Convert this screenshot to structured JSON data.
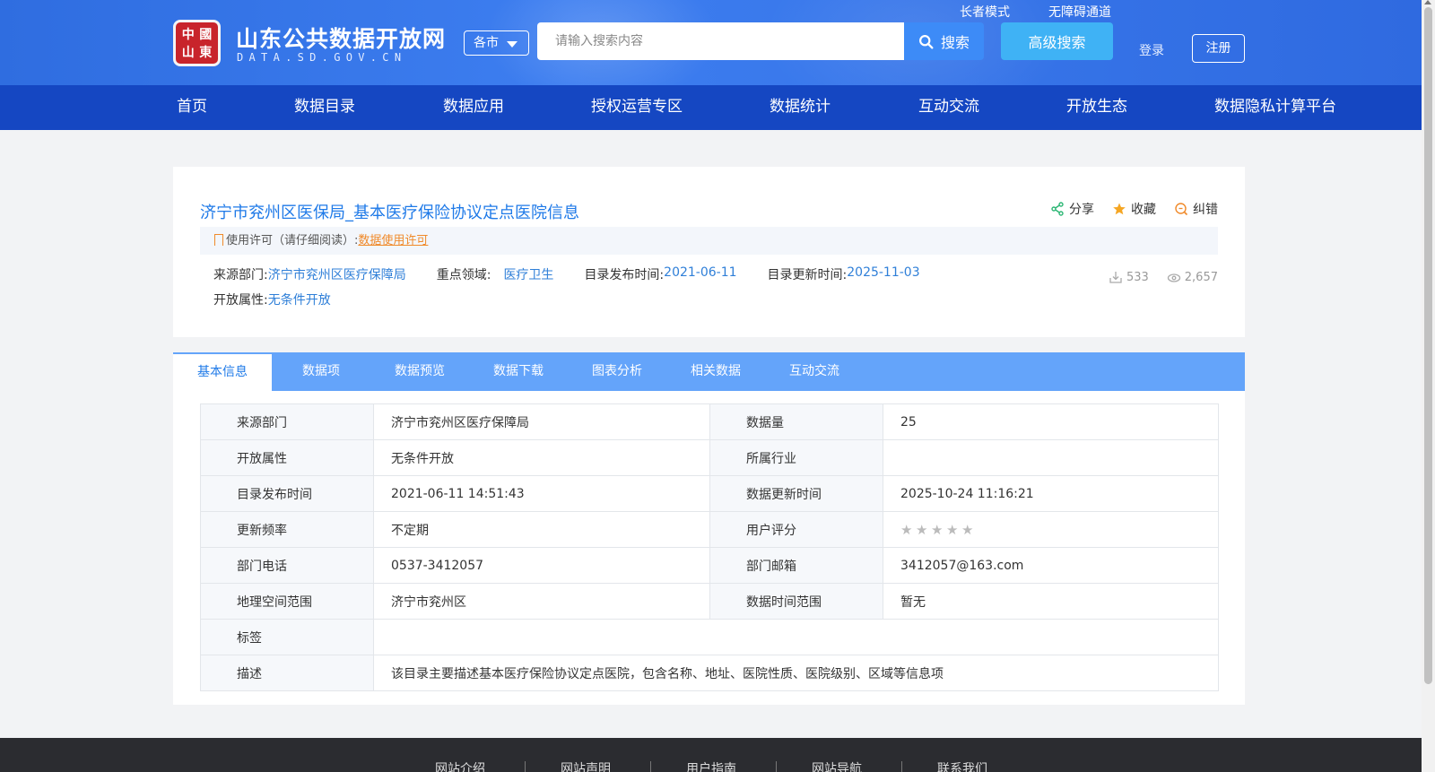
{
  "header": {
    "site_title": "山东公共数据开放网",
    "site_domain": "DATA.SD.GOV.CN",
    "logo_chars": [
      "中",
      "國",
      "山",
      "東"
    ],
    "city_select": "各市",
    "search_placeholder": "请输入搜索内容",
    "search_button": "搜索",
    "advanced_search": "高级搜索",
    "elder_mode": "长者模式",
    "accessibility": "无障碍通道",
    "login": "登录",
    "register": "注册"
  },
  "nav": {
    "items": [
      "首页",
      "数据目录",
      "数据应用",
      "授权运营专区",
      "数据统计",
      "互动交流",
      "开放生态",
      "数据隐私计算平台"
    ]
  },
  "dataset": {
    "title": "济宁市兖州区医保局_基本医疗保险协议定点医院信息",
    "actions": {
      "share": "分享",
      "favorite": "收藏",
      "report": "纠错"
    },
    "license_label": "使用许可（请仔细阅读）:",
    "license_link": "数据使用许可",
    "meta": {
      "source_label": "来源部门:",
      "source_value": "济宁市兖州区医疗保障局",
      "domain_label": "重点领域:",
      "domain_value": "医疗卫生",
      "published_label": "目录发布时间:",
      "published_value": "2021-06-11",
      "updated_label": "目录更新时间:",
      "updated_value": "2025-11-03",
      "open_label": "开放属性:",
      "open_value": "无条件开放"
    },
    "downloads": "533",
    "views": "2,657"
  },
  "tabs": [
    "基本信息",
    "数据项",
    "数据预览",
    "数据下载",
    "图表分析",
    "相关数据",
    "互动交流"
  ],
  "info_table": {
    "rows": [
      {
        "k1": "来源部门",
        "v1": "济宁市兖州区医疗保障局",
        "k2": "数据量",
        "v2": "25"
      },
      {
        "k1": "开放属性",
        "v1": "无条件开放",
        "k2": "所属行业",
        "v2": ""
      },
      {
        "k1": "目录发布时间",
        "v1": "2021-06-11 14:51:43",
        "k2": "数据更新时间",
        "v2": "2025-10-24 11:16:21"
      },
      {
        "k1": "更新频率",
        "v1": "不定期",
        "k2": "用户评分",
        "v2": ""
      },
      {
        "k1": "部门电话",
        "v1": "0537-3412057",
        "k2": "部门邮箱",
        "v2": "3412057@163.com"
      },
      {
        "k1": "地理空间范围",
        "v1": "济宁市兖州区",
        "k2": "数据时间范围",
        "v2": "暂无"
      }
    ],
    "tags_label": "标签",
    "tags_value": "",
    "desc_label": "描述",
    "desc_value": "该目录主要描述基本医疗保险协议定点医院，包含名称、地址、医院性质、医院级别、区域等信息项",
    "rating_stars": 0,
    "rating_max": 5
  },
  "footer": {
    "links": [
      "网站介绍",
      "网站声明",
      "用户指南",
      "网站导航",
      "联系我们"
    ]
  },
  "colors": {
    "header_blue": "#3d7ef0",
    "nav_blue": "#1547c2",
    "tab_blue": "#64a4fa",
    "link_blue": "#1f7ae8",
    "license_orange": "#f08a2a"
  }
}
